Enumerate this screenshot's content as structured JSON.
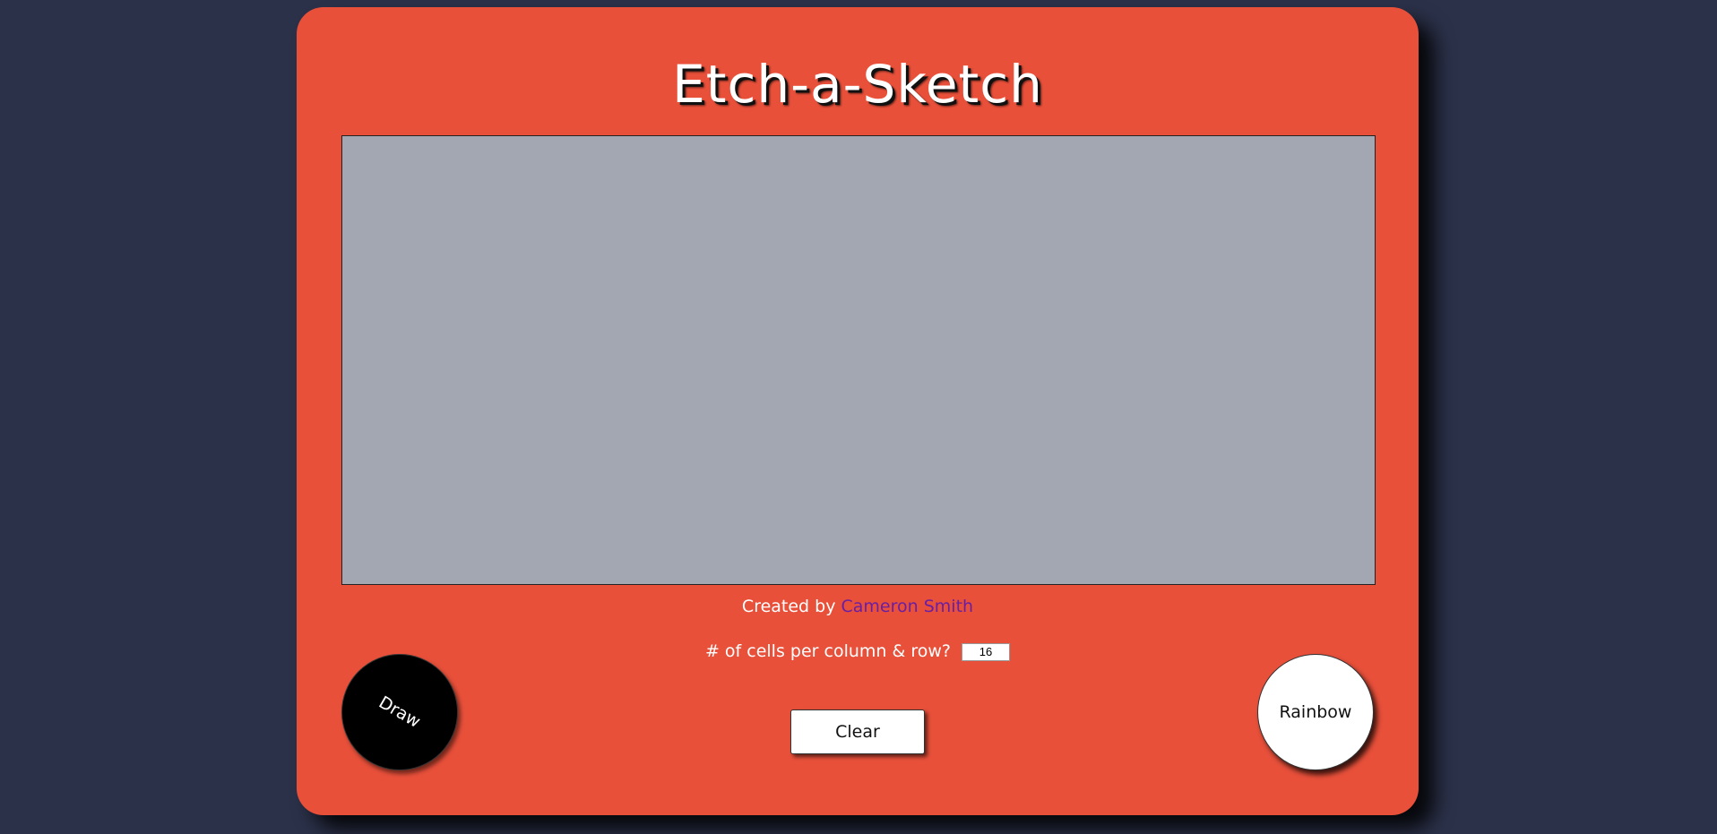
{
  "app": {
    "title": "Etch-a-Sketch"
  },
  "credit": {
    "prefix": "Created by",
    "author_link": "Cameron Smith"
  },
  "grid_control": {
    "label": "# of cells per column & row?",
    "value": "16"
  },
  "buttons": {
    "draw_label": "Draw",
    "clear_label": "Clear",
    "rainbow_label": "Rainbow"
  },
  "colors": {
    "background": "#2b3149",
    "frame": "#e8503a",
    "screen": "#a3a7b2",
    "author_link": "#6a1fa3"
  }
}
